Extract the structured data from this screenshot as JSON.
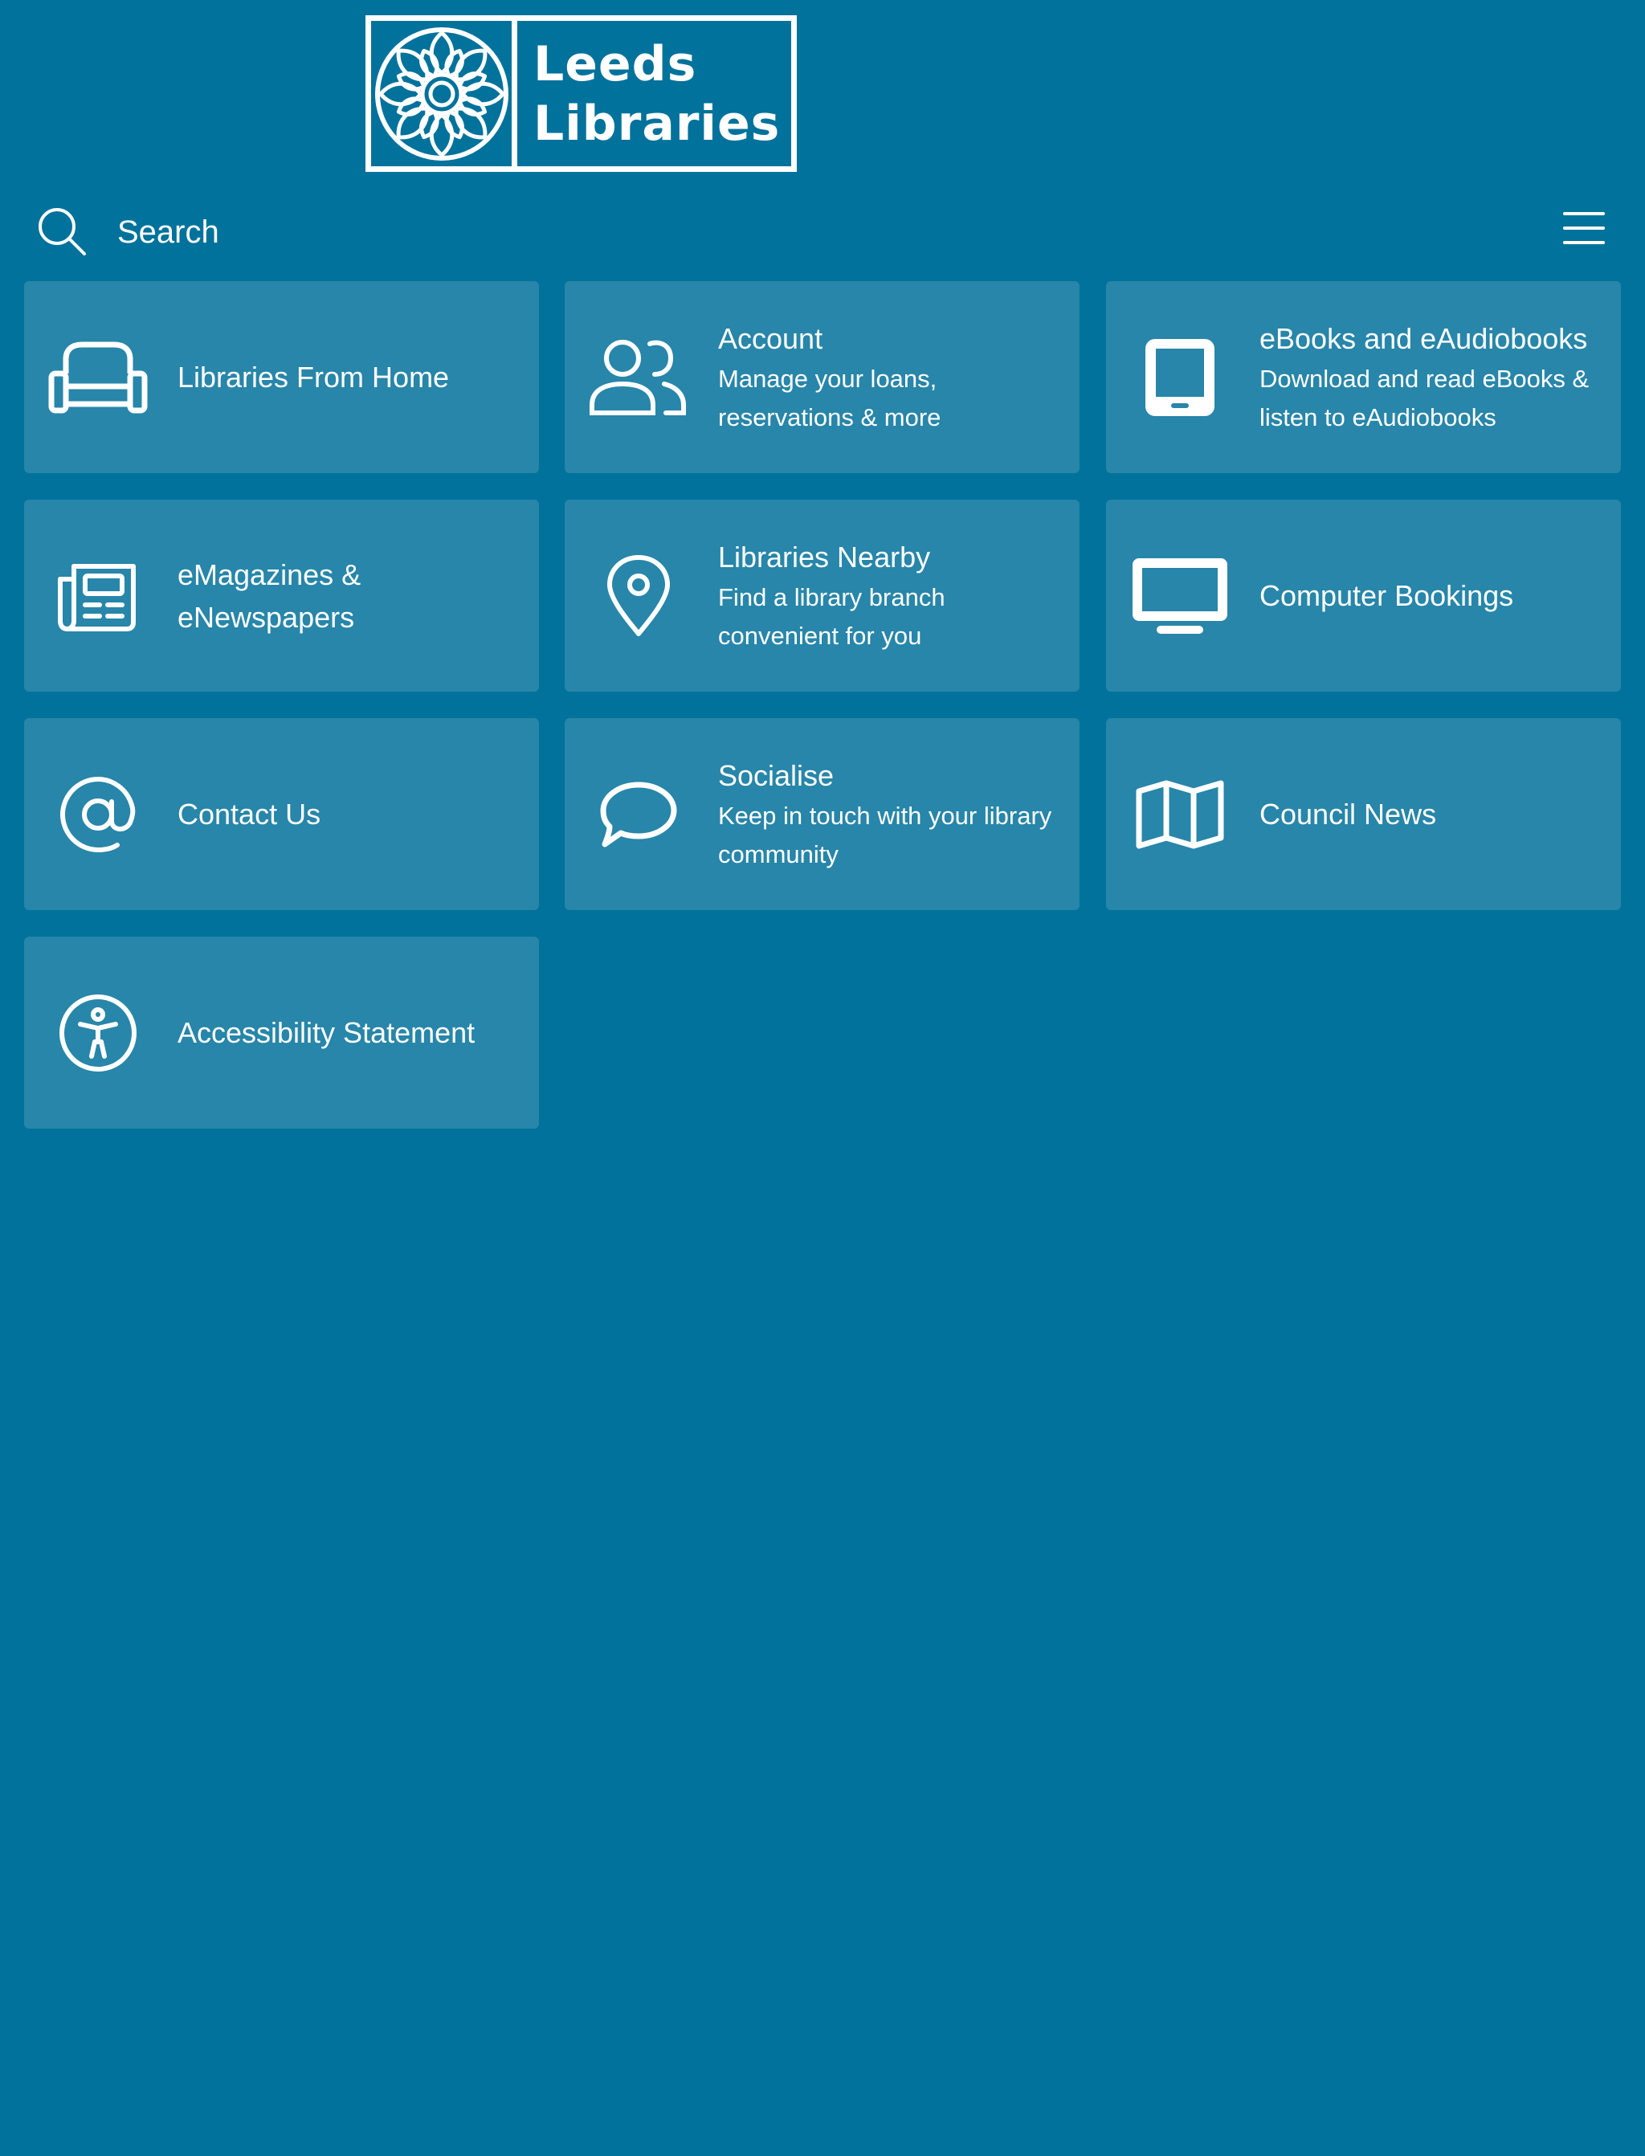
{
  "header": {
    "logo": {
      "line1": "Leeds",
      "line2": "Libraries"
    }
  },
  "search": {
    "placeholder": "Search"
  },
  "colors": {
    "background": "#01729b",
    "tile": "#2786a9",
    "foreground": "#ffffff"
  },
  "tiles": [
    {
      "title": "Libraries From Home",
      "description": "",
      "icon": "sofa-icon"
    },
    {
      "title": "Account",
      "description": "Manage your loans, reservations & more",
      "icon": "users-icon"
    },
    {
      "title": "eBooks and eAudiobooks",
      "description": "Download and read eBooks & listen to eAudiobooks",
      "icon": "tablet-icon"
    },
    {
      "title": "eMagazines & eNewspapers",
      "description": "",
      "icon": "newspaper-icon"
    },
    {
      "title": "Libraries Nearby",
      "description": "Find a library branch convenient for you",
      "icon": "map-pin-icon"
    },
    {
      "title": "Computer Bookings",
      "description": "",
      "icon": "monitor-icon"
    },
    {
      "title": "Contact Us",
      "description": "",
      "icon": "at-sign-icon"
    },
    {
      "title": "Socialise",
      "description": "Keep in touch with your library community",
      "icon": "chat-bubble-icon"
    },
    {
      "title": "Council News",
      "description": "",
      "icon": "map-icon"
    },
    {
      "title": "Accessibility Statement",
      "description": "",
      "icon": "accessibility-icon"
    }
  ]
}
